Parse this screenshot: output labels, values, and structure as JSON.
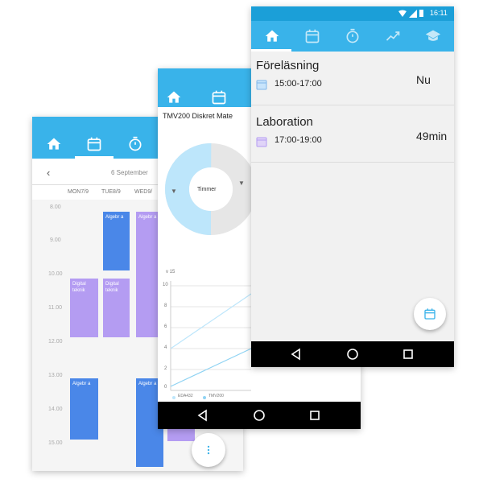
{
  "status_bar": {
    "time": "16:11"
  },
  "colors": {
    "accent": "#39b3ea",
    "event_blue": "#4a87e8",
    "event_purple": "#b49cf2",
    "donut_light": "#bde6fb",
    "donut_gray": "#e6e6e6"
  },
  "calendar_screen": {
    "date_title": "6 September",
    "prev_arrow": "‹",
    "day_headers": [
      "MON7/9",
      "TUE8/9",
      "WED9/"
    ],
    "times": [
      "8.00",
      "9.00",
      "10.00",
      "11.00",
      "12.00",
      "13.00",
      "14.00",
      "15.00"
    ],
    "events": [
      {
        "label": "Algebr a",
        "color": "blue"
      },
      {
        "label": "Algebr a",
        "color": "purple"
      },
      {
        "label": "Digital teknik",
        "color": "purple"
      },
      {
        "label": "Digital teknik",
        "color": "purple"
      },
      {
        "label": "Algebr a",
        "color": "blue"
      },
      {
        "label": "Algebr a",
        "color": "blue"
      }
    ]
  },
  "stats_screen": {
    "course_title": "TMV200 Diskret Mate",
    "donut_center": "Timmer",
    "y_axis_label": "v 15",
    "y_ticks": [
      "10",
      "8",
      "6",
      "4",
      "2",
      "0"
    ],
    "legend": [
      "EDA432",
      "TMV200"
    ]
  },
  "schedule_screen": {
    "items": [
      {
        "title": "Föreläsning",
        "time": "15:00-17:00",
        "status": "Nu"
      },
      {
        "title": "Laboration",
        "time": "17:00-19:00",
        "status": "49min"
      }
    ]
  },
  "icons": {
    "tabs": [
      "home-icon",
      "calendar-icon",
      "timer-icon",
      "trending-icon",
      "school-icon"
    ],
    "navbar": [
      "back-icon",
      "home-circle-icon",
      "recents-icon"
    ],
    "fab": [
      "calendar-icon",
      "more-vert-icon"
    ]
  }
}
